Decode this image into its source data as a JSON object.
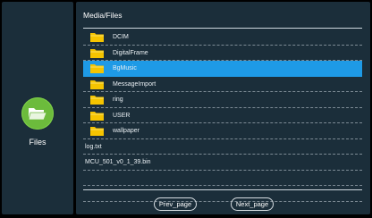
{
  "sidebar": {
    "app_icon": "folder-icon",
    "app_label": "Files",
    "icon_color": "#6cbb3c"
  },
  "main": {
    "title": "Media/Files",
    "items": [
      {
        "label": "DCIM",
        "type": "folder"
      },
      {
        "label": "DigitalFrame",
        "type": "folder"
      },
      {
        "label": "BgMusic",
        "type": "folder",
        "selected": true
      },
      {
        "label": "MessageImport",
        "type": "folder"
      },
      {
        "label": "ring",
        "type": "folder"
      },
      {
        "label": "USER",
        "type": "folder"
      },
      {
        "label": "wallpaper",
        "type": "folder"
      },
      {
        "label": "log.txt",
        "type": "file"
      },
      {
        "label": "MCU_501_v0_1_39.bin",
        "type": "file"
      }
    ],
    "empty_rows": 2
  },
  "pager": {
    "prev_label": "Prev_page",
    "next_label": "Next_page"
  },
  "colors": {
    "panel": "#1b2e3a",
    "selected": "#1e9ae6",
    "folder": "#f5c400"
  }
}
